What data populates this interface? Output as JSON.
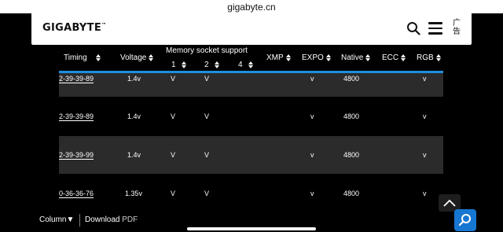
{
  "browser": {
    "url": "gigabyte.cn"
  },
  "header": {
    "logo": "GIGABYTE",
    "ad_label": "广告"
  },
  "table": {
    "columns": {
      "timing": "Timing",
      "voltage": "Voltage",
      "memory_socket": "Memory socket support",
      "socket_1": "1",
      "socket_2": "2",
      "socket_4": "4",
      "xmp": "XMP",
      "expo": "EXPO",
      "native": "Native",
      "ecc": "ECC",
      "rgb": "RGB"
    },
    "rows": [
      {
        "timing": "2-39-39-89",
        "voltage": "1.4v",
        "s1": "V",
        "s2": "V",
        "expo": "v",
        "native": "4800",
        "rgb": "v"
      },
      {
        "timing": "2-39-39-89",
        "voltage": "1.4v",
        "s1": "V",
        "s2": "V",
        "expo": "v",
        "native": "4800",
        "rgb": "v"
      },
      {
        "timing": "2-39-39-99",
        "voltage": "1.4v",
        "s1": "V",
        "s2": "V",
        "expo": "v",
        "native": "4800",
        "rgb": "v"
      },
      {
        "timing": "0-36-36-76",
        "voltage": "1.35v",
        "s1": "V",
        "s2": "V",
        "expo": "v",
        "native": "4800",
        "rgb": "v"
      }
    ]
  },
  "footer": {
    "column_label": "Column▼",
    "download_label": "Download",
    "download_format": "PDF"
  },
  "colors": {
    "accent_blue": "#1d8fe0",
    "fab_blue": "#1677d2",
    "row_alt": "#2b2b2b"
  }
}
